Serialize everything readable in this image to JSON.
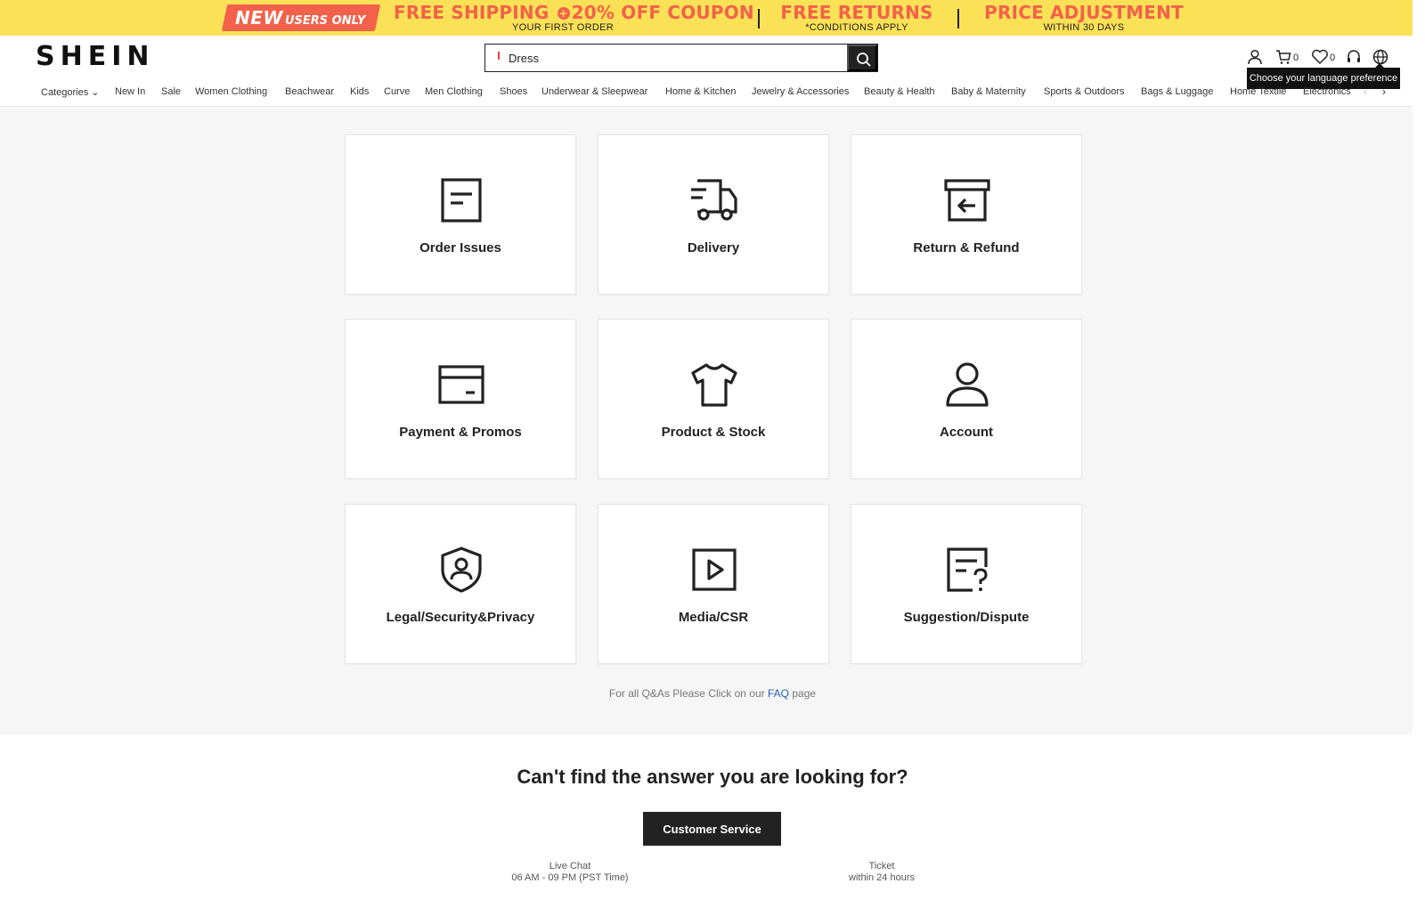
{
  "promo": {
    "new_badge_big": "NEW",
    "new_badge_small": "USERS ONLY",
    "offer1_main_a": "FREE SHIPPING",
    "offer1_plus": "+",
    "offer1_main_b": "20% OFF COUPON",
    "offer1_sub": "YOUR FIRST ORDER",
    "offer2_main": "FREE RETURNS",
    "offer2_sub": "*CONDITIONS APPLY",
    "offer3_main": "PRICE ADJUSTMENT",
    "offer3_sub": "WITHIN 30 DAYS"
  },
  "header": {
    "logo": "SHEIN",
    "search_value": "Dress",
    "cart_count": "0",
    "wishlist_count": "0",
    "language_tooltip": "Choose your language preference"
  },
  "nav": {
    "items": [
      "Categories",
      "New In",
      "Sale",
      "Women Clothing",
      "Beachwear",
      "Kids",
      "Curve",
      "Men Clothing",
      "Shoes",
      "Underwear & Sleepwear",
      "Home & Kitchen",
      "Jewelry & Accessories",
      "Beauty & Health",
      "Baby & Maternity",
      "Sports & Outdoors",
      "Bags & Luggage",
      "Home Textile",
      "Electronics"
    ]
  },
  "cards": [
    {
      "label": "Order Issues",
      "icon": "order-document-icon"
    },
    {
      "label": "Delivery",
      "icon": "delivery-truck-icon"
    },
    {
      "label": "Return & Refund",
      "icon": "return-box-icon"
    },
    {
      "label": "Payment & Promos",
      "icon": "payment-card-icon"
    },
    {
      "label": "Product & Stock",
      "icon": "tshirt-icon"
    },
    {
      "label": "Account",
      "icon": "user-icon"
    },
    {
      "label": "Legal/Security&Privacy",
      "icon": "security-shield-icon"
    },
    {
      "label": "Media/CSR",
      "icon": "media-play-icon"
    },
    {
      "label": "Suggestion/Dispute",
      "icon": "suggestion-question-icon"
    }
  ],
  "faq": {
    "prefix": "For all Q&As Please Click on our",
    "link": "FAQ",
    "suffix": "page"
  },
  "bottom": {
    "heading": "Can't find the answer you are looking for?",
    "button": "Customer Service",
    "live_chat_title": "Live Chat",
    "live_chat_hours": "06 AM - 09 PM (PST Time)",
    "ticket_title": "Ticket",
    "ticket_hours": "within 24 hours"
  }
}
